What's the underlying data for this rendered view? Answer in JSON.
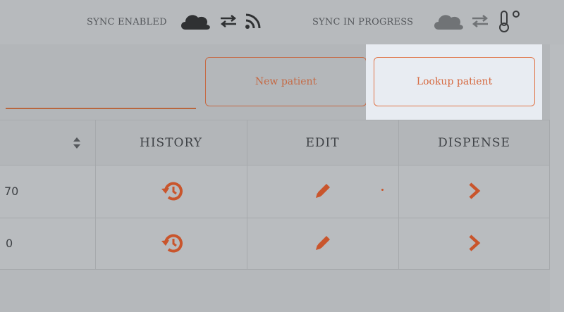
{
  "status_bar": {
    "sync_enabled_label": "SYNC ENABLED",
    "sync_in_progress_label": "SYNC IN PROGRESS",
    "icons": [
      "cloud-icon",
      "arrows-swap-icon",
      "rss-feed-icon",
      "cloud-icon",
      "arrows-swap-icon",
      "thermometer-icon"
    ]
  },
  "toolbar": {
    "new_patient_label": "New patient",
    "lookup_patient_label": "Lookup patient"
  },
  "table": {
    "columns": {
      "sort": "",
      "history": "HISTORY",
      "edit": "EDIT",
      "dispense": "DISPENSE"
    },
    "rows": [
      {
        "partial_value": "70"
      },
      {
        "partial_value": "0"
      }
    ]
  },
  "colors": {
    "accent": "#c9552c",
    "highlight": "#e8ecf2",
    "text": "#3f4246"
  }
}
